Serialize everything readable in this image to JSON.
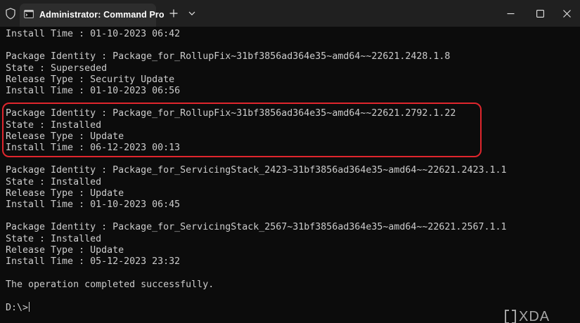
{
  "window": {
    "tab_title": "Administrator: Command Pro",
    "icons": {
      "shield": "shield-icon",
      "terminal": "terminal-icon",
      "new_tab": "plus-icon",
      "dropdown": "chevron-down-icon",
      "minimize": "minimize-icon",
      "maximize": "maximize-icon",
      "close": "close-icon"
    }
  },
  "terminal": {
    "lines": [
      "Install Time : 01-10-2023 06:42",
      "",
      "Package Identity : Package_for_RollupFix~31bf3856ad364e35~amd64~~22621.2428.1.8",
      "State : Superseded",
      "Release Type : Security Update",
      "Install Time : 01-10-2023 06:56",
      "",
      "Package Identity : Package_for_RollupFix~31bf3856ad364e35~amd64~~22621.2792.1.22",
      "State : Installed",
      "Release Type : Update",
      "Install Time : 06-12-2023 00:13",
      "",
      "Package Identity : Package_for_ServicingStack_2423~31bf3856ad364e35~amd64~~22621.2423.1.1",
      "State : Installed",
      "Release Type : Update",
      "Install Time : 01-10-2023 06:45",
      "",
      "Package Identity : Package_for_ServicingStack_2567~31bf3856ad364e35~amd64~~22621.2567.1.1",
      "State : Installed",
      "Release Type : Update",
      "Install Time : 05-12-2023 23:32",
      "",
      "The operation completed successfully.",
      ""
    ],
    "prompt": "D:\\>",
    "highlight_color": "#e0262d"
  },
  "watermark": {
    "text": "XDA",
    "logo": "xda-logo-icon"
  },
  "colors": {
    "background": "#0c0c0c",
    "titlebar": "#202020",
    "tab": "#2d2d2d",
    "text": "#cccccc"
  }
}
